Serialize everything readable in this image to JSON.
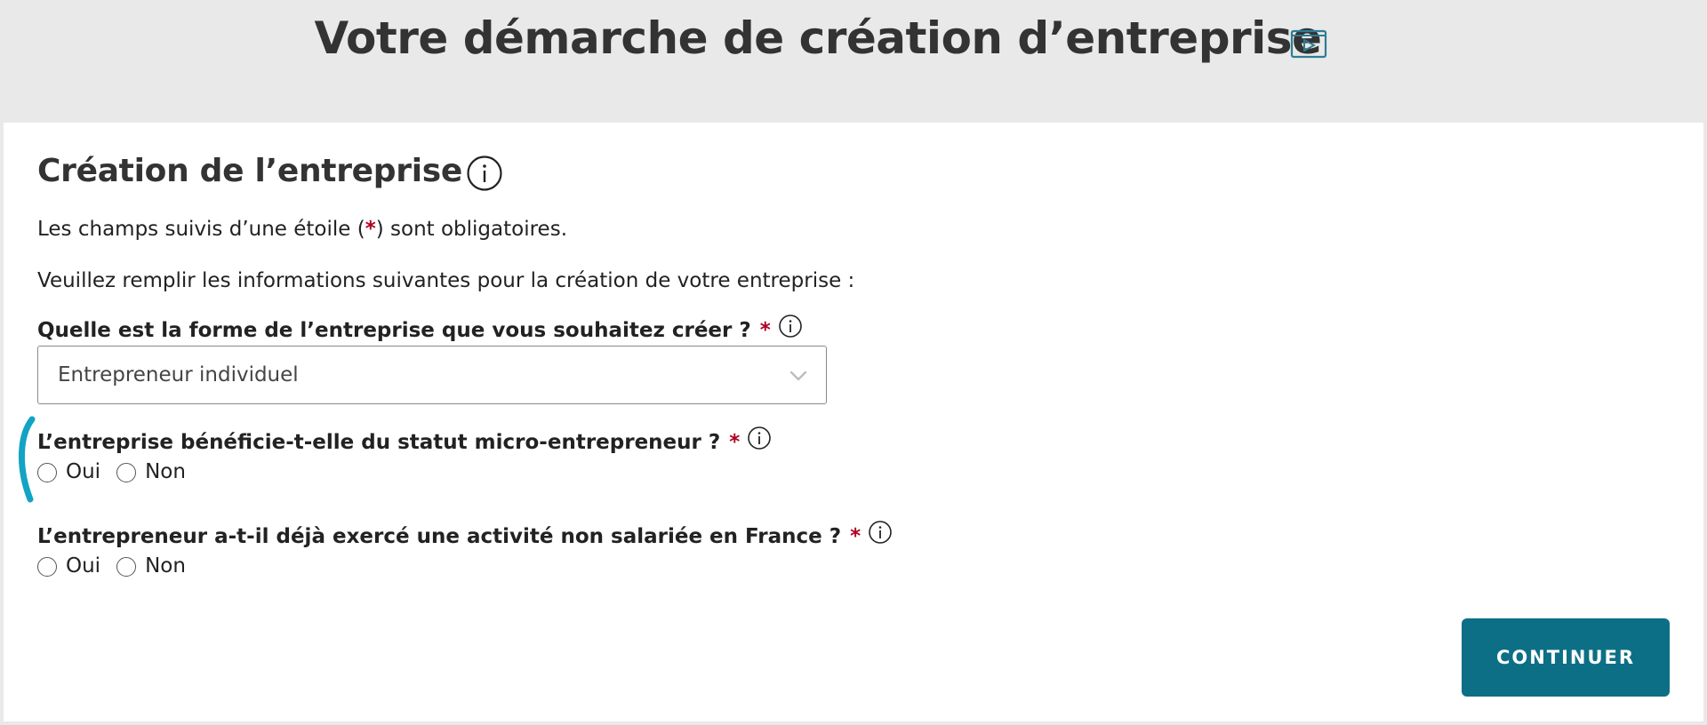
{
  "header": {
    "title": "Votre démarche de création d’entreprise",
    "video_icon": "video-play-icon",
    "accent_color": "#2e7c96"
  },
  "card": {
    "title": "Création de l’entreprise",
    "title_icon": "info-icon",
    "required_note": {
      "before": "Les champs suivis d’une étoile (",
      "star": "*",
      "after": ") sont obligatoires."
    },
    "intro": "Veuillez remplir les informations suivantes pour la création de votre entreprise :"
  },
  "form": {
    "company_form": {
      "label": "Quelle est la forme de l’entreprise que vous souhaitez créer ?",
      "required": "*",
      "selected": "Entrepreneur individuel"
    },
    "micro_status": {
      "label": "L’entreprise bénéficie-t-elle du statut micro-entrepreneur ?",
      "required": "*",
      "options": [
        "Oui",
        "Non"
      ]
    },
    "prior_activity": {
      "label": "L’entrepreneur a-t-il déjà exercé une activité non salariée en France ?",
      "required": "*",
      "options": [
        "Oui",
        "Non"
      ]
    }
  },
  "actions": {
    "continue_label": "CONTINUER",
    "button_color": "#0c6f86"
  },
  "colors": {
    "required_star": "#b00020",
    "highlight_mark": "#13a3c4"
  }
}
